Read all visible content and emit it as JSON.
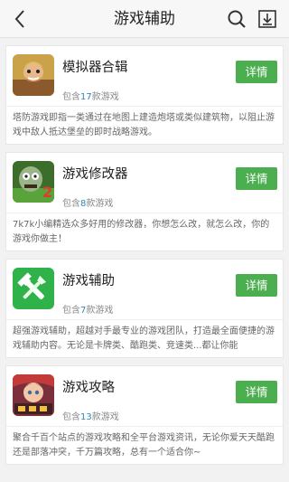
{
  "header": {
    "title": "游戏辅助",
    "back_icon": "back-arrow-icon",
    "search_icon": "search-icon",
    "download_icon": "download-icon"
  },
  "colors": {
    "accent_green": "#4bae4f",
    "count_blue": "#2a8ab8",
    "background": "#f2f2f2"
  },
  "cards": [
    {
      "name": "模拟器合辑",
      "count_prefix": "包含",
      "count": "17",
      "count_suffix": "款游戏",
      "button": "详情",
      "description": "塔防游戏即指一类通过在地图上建造炮塔或类似建筑物，以阻止游戏中敌人抵达堡垒的即时战略游戏。",
      "icon": "clash-of-clans-icon"
    },
    {
      "name": "游戏修改器",
      "count_prefix": "包含",
      "count": "8",
      "count_suffix": "款游戏",
      "button": "详情",
      "description": "7k7k小编精选众多好用的修改器，你想怎么改，就怎么改，你的游戏你做主！",
      "icon": "plants-vs-zombies-icon"
    },
    {
      "name": "游戏辅助",
      "count_prefix": "包含",
      "count": "7",
      "count_suffix": "款游戏",
      "button": "详情",
      "description": "超强游戏辅助，超越对手最专业的游戏团队，打造最全面便捷的游戏辅助内容。无论是卡牌类、酷跑类、竞速类...都让你能",
      "icon": "wrench-icon"
    },
    {
      "name": "游戏攻略",
      "count_prefix": "包含",
      "count": "13",
      "count_suffix": "款游戏",
      "button": "详情",
      "description": "聚合千百个站点的游戏攻略和全平台游戏资讯，无论你爱天天酷跑还是部落冲突，千万篇攻略，总有一个适合你~",
      "icon": "game-guide-icon"
    }
  ]
}
